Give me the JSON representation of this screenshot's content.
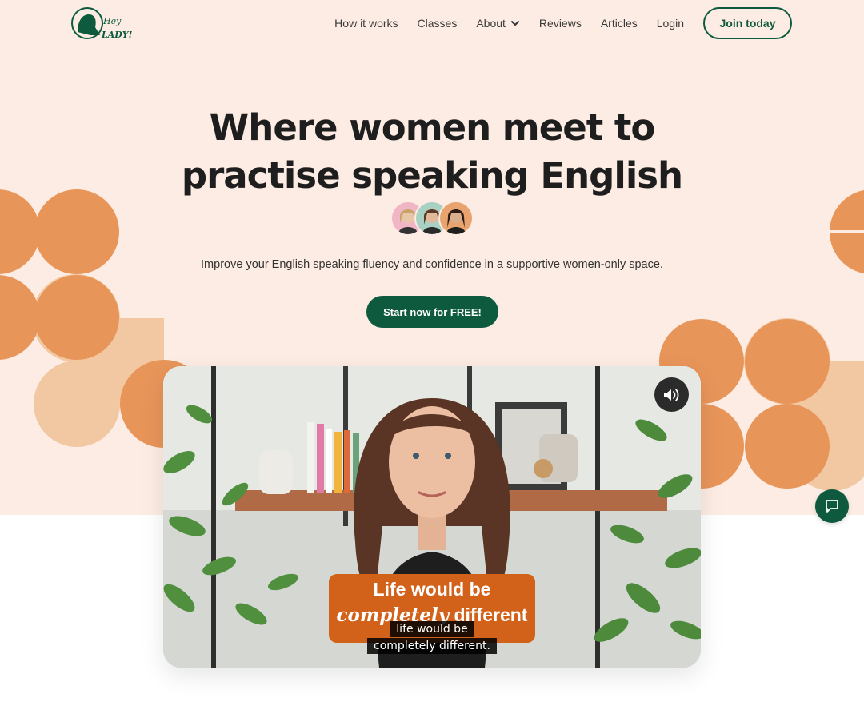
{
  "header": {
    "logo_text": "Hey LADY!",
    "nav": [
      "How it works",
      "Classes",
      "About",
      "Reviews",
      "Articles",
      "Login"
    ],
    "join_label": "Join today"
  },
  "hero": {
    "title_line1": "Where women meet to",
    "title_line2": "practise speaking English",
    "subtitle": "Improve your English speaking fluency and confidence in a supportive women-only space.",
    "cta_label": "Start now for FREE!"
  },
  "video": {
    "overlay_line1": "Life would be",
    "overlay_word_script": "completely",
    "overlay_word_rest": "different",
    "caption_line1": "life would be",
    "caption_line2": "completely different."
  },
  "colors": {
    "brand_green": "#0d5a3f",
    "hero_bg": "#fcece3",
    "accent_orange": "#e8955a",
    "accent_peach": "#f2c8a2"
  },
  "icons": [
    "chevron-down-icon",
    "speaker-icon",
    "chat-icon"
  ]
}
